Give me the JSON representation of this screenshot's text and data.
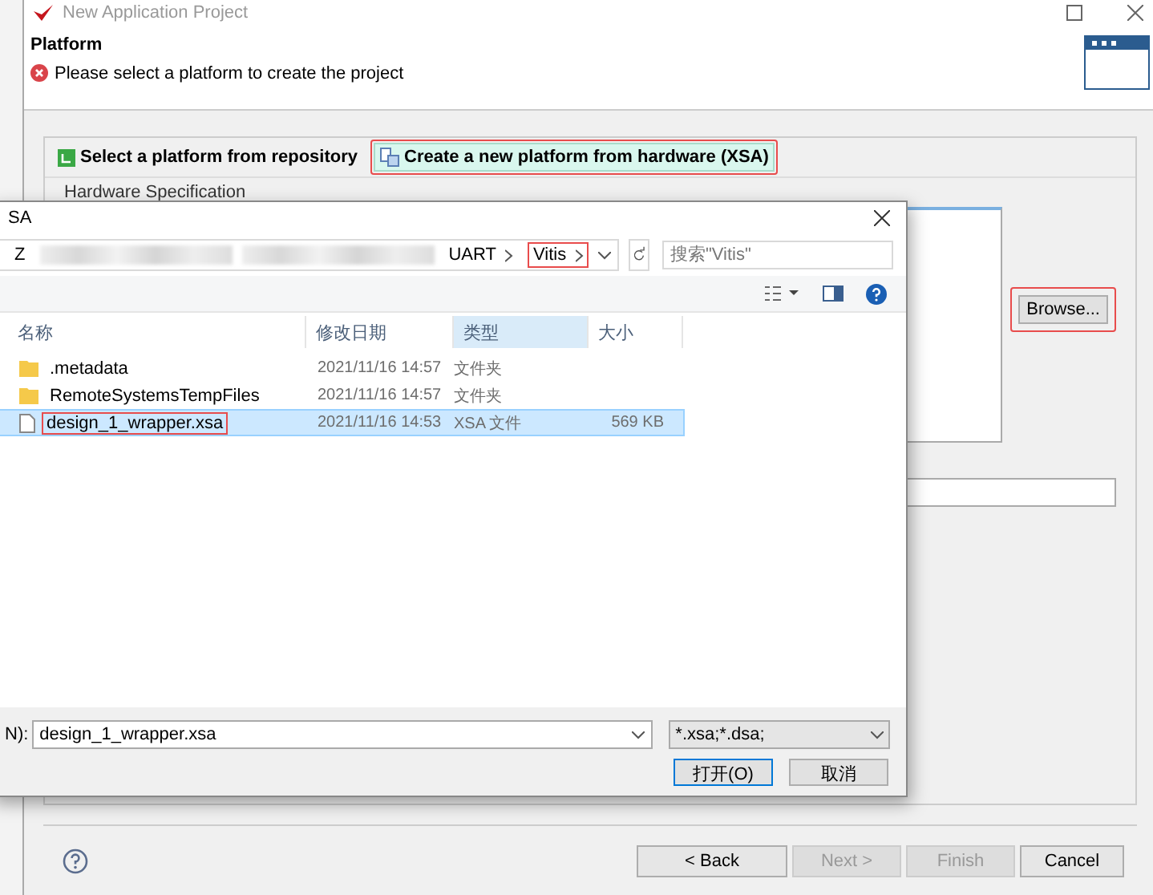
{
  "wizard": {
    "title": "New Application Project",
    "header": {
      "title": "Platform",
      "message": "Please select a platform to create the project"
    },
    "tabs": [
      {
        "label": "Select a platform from repository",
        "selected": false,
        "highlighted": false,
        "kind": "repository"
      },
      {
        "label": "Create a new platform from hardware (XSA)",
        "selected": true,
        "highlighted": true,
        "kind": "hardware"
      }
    ],
    "section_label": "Hardware Specification",
    "browse": {
      "label": "Browse...",
      "highlighted": true
    },
    "buttons": [
      {
        "label": "< Back",
        "disabled": false
      },
      {
        "label": "Next >",
        "disabled": true
      },
      {
        "label": "Finish",
        "disabled": true
      },
      {
        "label": "Cancel",
        "disabled": false
      }
    ]
  },
  "file_dialog": {
    "title": "SA",
    "path": [
      {
        "label": "Z",
        "redacted_after": true,
        "highlighted": false
      },
      {
        "label": "UART",
        "redacted_after": false,
        "highlighted": false
      },
      {
        "label": "Vitis",
        "redacted_after": false,
        "highlighted": true
      }
    ],
    "search": {
      "placeholder": "搜索\"Vitis\""
    },
    "columns": [
      {
        "label": "名称",
        "sorted": false
      },
      {
        "label": "修改日期",
        "sorted": false
      },
      {
        "label": "类型",
        "sorted": true
      },
      {
        "label": "大小",
        "sorted": false
      }
    ],
    "rows": [
      {
        "name": ".metadata",
        "date": "2021/11/16 14:57",
        "type": "文件夹",
        "kind": "folder",
        "selected": false,
        "highlighted": false
      },
      {
        "name": "RemoteSystemsTempFiles",
        "date": "2021/11/16 14:57",
        "type": "文件夹",
        "kind": "folder",
        "selected": false,
        "highlighted": false
      },
      {
        "name": "design_1_wrapper.xsa",
        "date": "2021/11/16 14:53",
        "type": "XSA 文件",
        "size": "569 KB",
        "kind": "file",
        "selected": true,
        "highlighted": true
      }
    ],
    "filename_label": "N):",
    "filename": "design_1_wrapper.xsa",
    "filter": "*.xsa;*.dsa;",
    "buttons": [
      {
        "label": "打开(O)",
        "default": true
      },
      {
        "label": "取消",
        "default": false
      }
    ]
  }
}
